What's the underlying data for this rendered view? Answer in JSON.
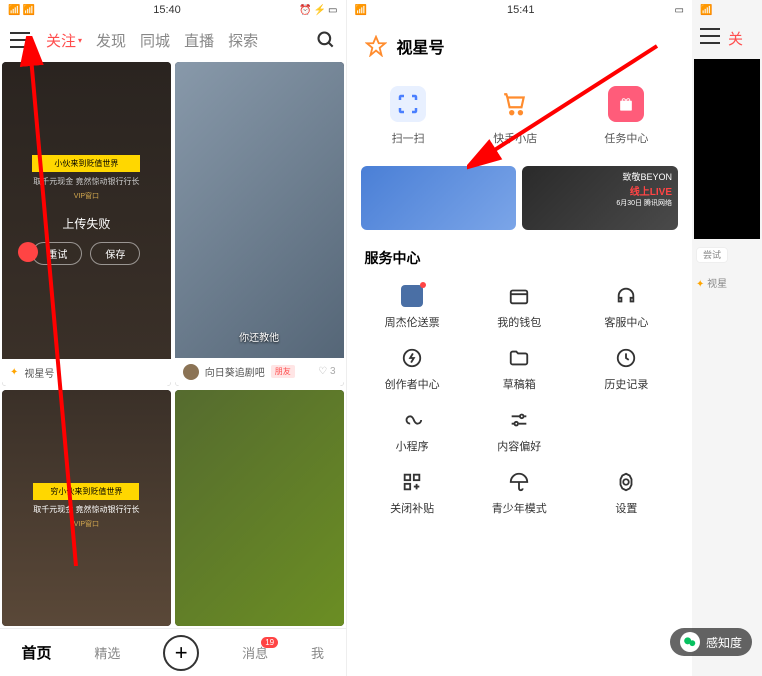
{
  "left": {
    "status": {
      "time": "15:40",
      "signal": "5G",
      "battery": "▢"
    },
    "nav": {
      "tabs": [
        "关注",
        "发现",
        "同城",
        "直播",
        "探索"
      ],
      "active_index": 0
    },
    "feed": {
      "card1": {
        "yellow": "小伙来到贬值世界",
        "line2": "取千元现金 竟然惊动银行行长",
        "vip": "VIP窗口",
        "upload_fail": "上传失败",
        "btn_retry": "重试",
        "btn_save": "保存",
        "footer": "视星号"
      },
      "card2": {
        "caption": "你还教他",
        "footer": "向日葵追剧吧",
        "tag": "朋友",
        "likes": "3"
      },
      "card3": {
        "yellow": "穷小伙来到贬值世界",
        "line2": "取千元现金 竟然惊动银行行长",
        "vip": "VIP窗口"
      }
    },
    "bottom": {
      "home": "首页",
      "featured": "精选",
      "message": "消息",
      "me": "我",
      "msg_badge": "19"
    }
  },
  "right": {
    "status": {
      "time": "15:41",
      "signal": "5G"
    },
    "sidebar_title": "视星号",
    "quick": [
      {
        "label": "扫一扫",
        "color": "#4a7fff"
      },
      {
        "label": "快手小店",
        "color": "#ff8c2e"
      },
      {
        "label": "任务中心",
        "color": "#ff5c7a"
      }
    ],
    "banners": {
      "b_text": "致敬BEYON",
      "b_text2": "线上LIVE",
      "b_text3": "6月30日 腾讯网络"
    },
    "services_title": "服务中心",
    "services": [
      {
        "label": "周杰伦送票",
        "icon": "avatar",
        "dot": true
      },
      {
        "label": "我的钱包",
        "icon": "wallet"
      },
      {
        "label": "客服中心",
        "icon": "headset"
      },
      {
        "label": "创作者中心",
        "icon": "bolt"
      },
      {
        "label": "草稿箱",
        "icon": "folder"
      },
      {
        "label": "历史记录",
        "icon": "clock"
      },
      {
        "label": "小程序",
        "icon": "infinity"
      },
      {
        "label": "内容偏好",
        "icon": "tune"
      },
      {
        "label": "",
        "icon": ""
      },
      {
        "label": "关闭补贴",
        "icon": "grid"
      },
      {
        "label": "青少年模式",
        "icon": "umbrella"
      },
      {
        "label": "设置",
        "icon": "gear"
      }
    ]
  },
  "edge": {
    "btn_trial": "尝试",
    "star": "视星"
  },
  "wechat_label": "感知度"
}
